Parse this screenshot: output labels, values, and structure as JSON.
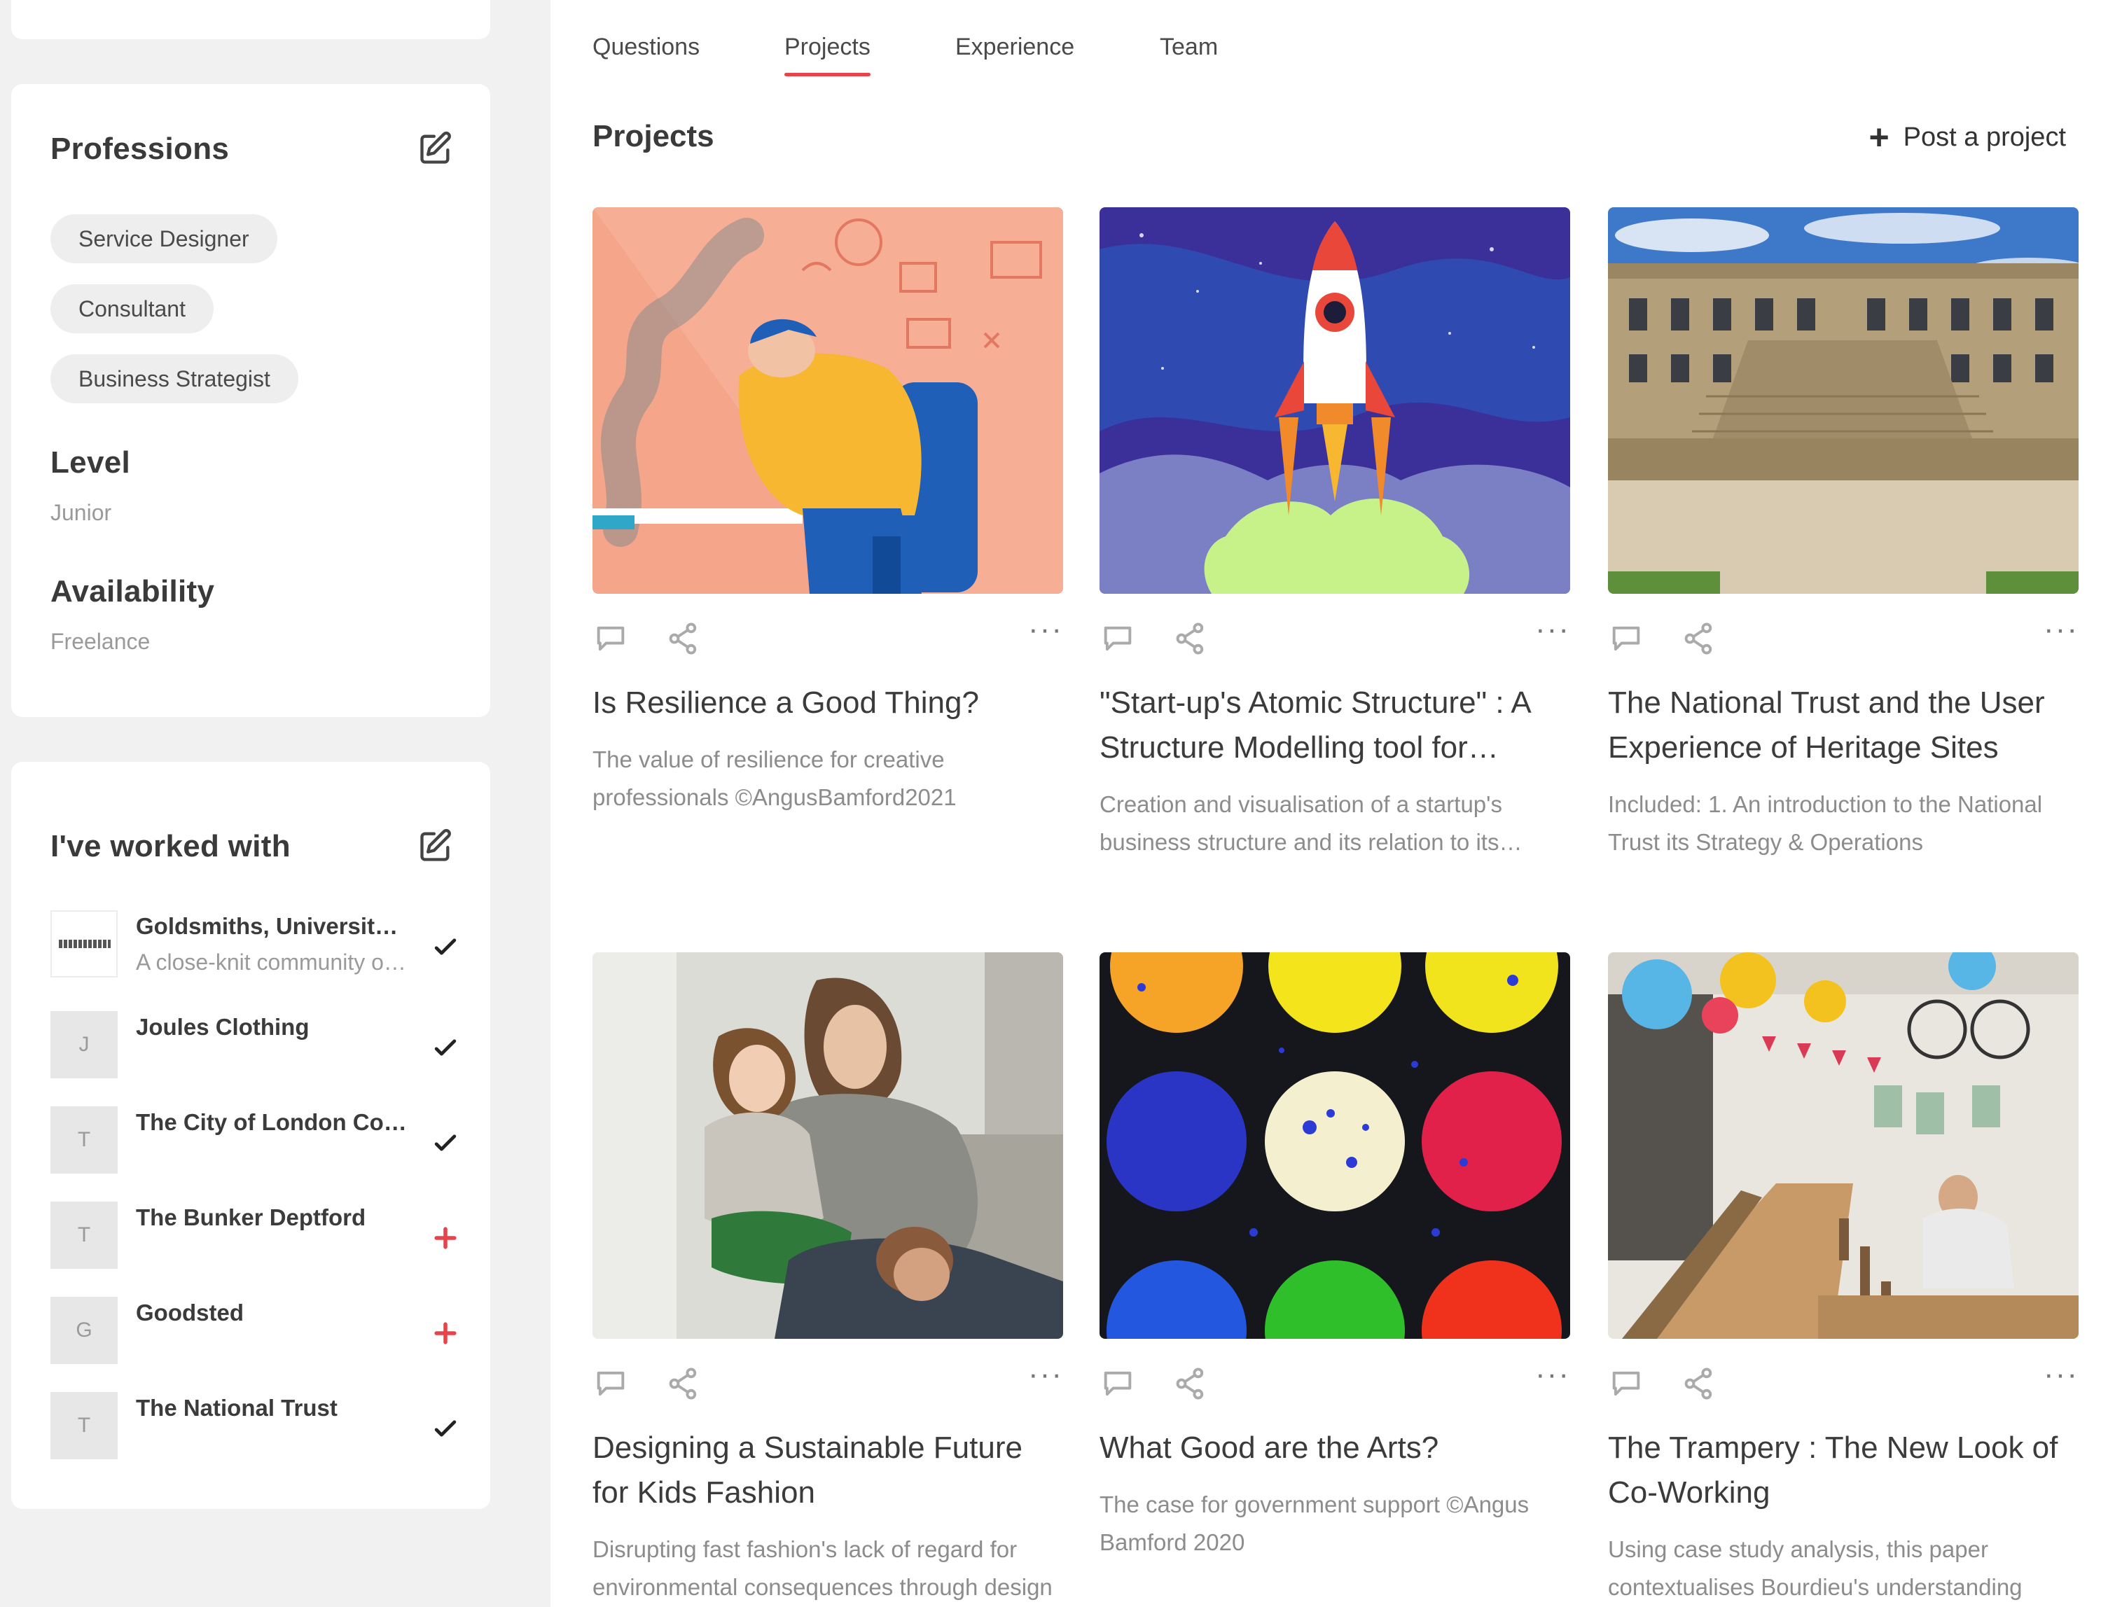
{
  "tabs": [
    {
      "label": "Questions"
    },
    {
      "label": "Projects"
    },
    {
      "label": "Experience"
    },
    {
      "label": "Team"
    }
  ],
  "active_tab": "Projects",
  "accent_color": "#e8424a",
  "sidebar": {
    "professions": {
      "heading": "Professions",
      "items": [
        "Service Designer",
        "Consultant",
        "Business Strategist"
      ]
    },
    "level": {
      "heading": "Level",
      "value": "Junior"
    },
    "availability": {
      "heading": "Availability",
      "value": "Freelance"
    },
    "worked_with": {
      "heading": "I've worked with",
      "items": [
        {
          "name": "Goldsmiths, University of London",
          "desc": "A close-knit community of ...",
          "logo": "",
          "status": "check"
        },
        {
          "name": "Joules Clothing",
          "desc": "",
          "logo": "J",
          "status": "check"
        },
        {
          "name": "The City of London Corporation",
          "desc": "",
          "logo": "T",
          "status": "check"
        },
        {
          "name": "The Bunker Deptford",
          "desc": "",
          "logo": "T",
          "status": "add"
        },
        {
          "name": "Goodsted",
          "desc": "",
          "logo": "G",
          "status": "add"
        },
        {
          "name": "The National Trust",
          "desc": "",
          "logo": "T",
          "status": "check"
        }
      ]
    }
  },
  "projects": {
    "title": "Projects",
    "post_label": "Post a project",
    "items": [
      {
        "title": "Is Resilience a Good Thing?",
        "desc": "The value of resilience for creative professionals ©AngusBamford2021",
        "image": "burnout-illustration"
      },
      {
        "title": "\"Start-up's Atomic Structure\" : A Structure Modelling tool for startups",
        "desc": "Creation and visualisation of a startup's business structure and its relation to its ecosystem",
        "image": "rocket-illustration"
      },
      {
        "title": "The National Trust and the User Experience of Heritage Sites",
        "desc": "Included: 1. An introduction to the National Trust its Strategy & Operations",
        "image": "stately-home-photo"
      },
      {
        "title": "Designing a Sustainable Future for Kids Fashion",
        "desc": "Disrupting fast fashion's lack of regard for environmental consequences through design",
        "image": "family-photo"
      },
      {
        "title": "What Good are the Arts?",
        "desc": "The case for government support ©Angus Bamford 2020",
        "image": "paint-palette-photo"
      },
      {
        "title": "The Trampery : The New Look of Co-Working",
        "desc": "Using case study analysis, this paper contextualises Bourdieu's understanding",
        "image": "coworking-space-photo"
      }
    ]
  }
}
